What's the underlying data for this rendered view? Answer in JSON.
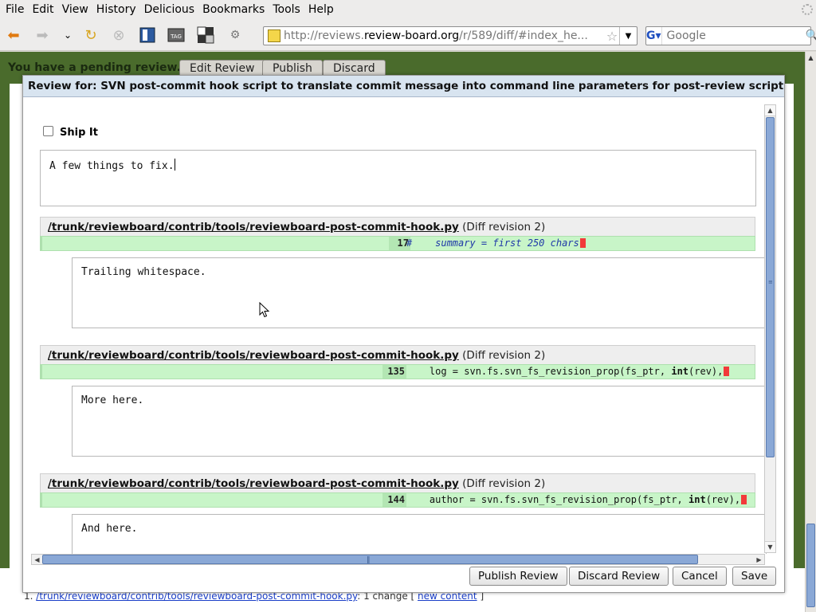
{
  "browser": {
    "menu": [
      "File",
      "Edit",
      "View",
      "History",
      "Delicious",
      "Bookmarks",
      "Tools",
      "Help"
    ],
    "url_prefix": "http://reviews.",
    "url_domain": "review-board.org",
    "url_path": "/r/589/diff/#index_he...",
    "search_placeholder": "Google"
  },
  "page": {
    "pending_text": "You have a pending review.",
    "edit_review": "Edit Review",
    "publish": "Publish",
    "discard": "Discard",
    "footer_num": "1.",
    "footer_file": "/trunk/reviewboard/contrib/tools/reviewboard-post-commit-hook.py",
    "footer_change": ": 1 change [",
    "footer_new": "new content",
    "footer_close": "]"
  },
  "dialog": {
    "title": "Review for: SVN post-commit hook script to translate commit message into command line parameters for post-review script",
    "ship_it_label": "Ship It",
    "body_top": "A few things to fix.",
    "comments": [
      {
        "file": "/trunk/reviewboard/contrib/tools/reviewboard-post-commit-hook.py",
        "revision": "(Diff revision 2)",
        "line": "17",
        "code_pre": "#    summary = first 250 chars",
        "code_kw": "",
        "code_post": "",
        "comment": "Trailing whitespace."
      },
      {
        "file": "/trunk/reviewboard/contrib/tools/reviewboard-post-commit-hook.py",
        "revision": "(Diff revision 2)",
        "line": "135",
        "code_pre": "    log = svn.fs.svn_fs_revision_prop(fs_ptr, ",
        "code_kw": "int",
        "code_post": "(rev),",
        "comment": "More here."
      },
      {
        "file": "/trunk/reviewboard/contrib/tools/reviewboard-post-commit-hook.py",
        "revision": "(Diff revision 2)",
        "line": "144",
        "code_pre": "    author = svn.fs.svn_fs_revision_prop(fs_ptr, ",
        "code_kw": "int",
        "code_post": "(rev),",
        "comment": "And here."
      }
    ],
    "buttons": {
      "publish_review": "Publish Review",
      "discard_review": "Discard Review",
      "cancel": "Cancel",
      "save": "Save"
    }
  }
}
